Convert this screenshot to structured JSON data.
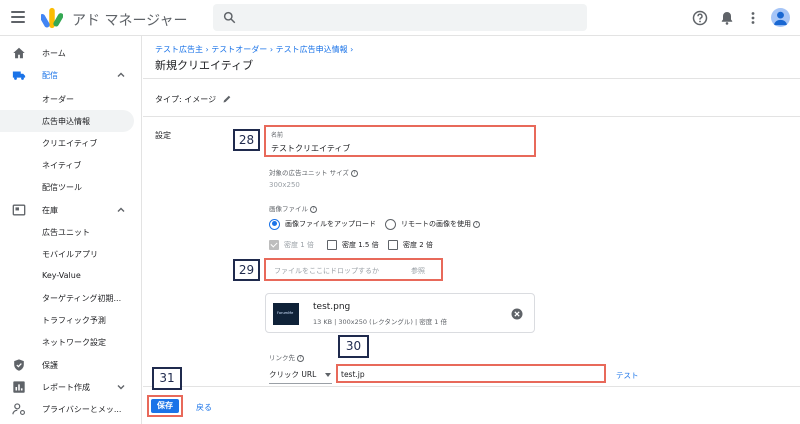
{
  "app": {
    "title": "アド マネージャー"
  },
  "sidebar": {
    "home": "ホーム",
    "delivery": "配信",
    "delivery_items": [
      "オーダー",
      "広告申込情報",
      "クリエイティブ",
      "ネイティブ",
      "配信ツール"
    ],
    "inventory": "在庫",
    "inventory_items": [
      "広告ユニット",
      "モバイルアプリ",
      "Key-Value",
      "ターゲティング初期...",
      "トラフィック予測",
      "ネットワーク設定"
    ],
    "protection": "保護",
    "reporting": "レポート作成",
    "privacy": "プライバシーとメッ..."
  },
  "breadcrumb": {
    "items": [
      "テスト広告主",
      "テストオーダー",
      "テスト広告申込情報"
    ],
    "separator": "›"
  },
  "page": {
    "title": "新規クリエイティブ",
    "type_label": "タイプ: イメージ"
  },
  "form": {
    "settings_label": "設定",
    "name_caption": "名前",
    "name_value": "テストクリエイティブ",
    "ad_unit_size_label": "対象の広告ユニット サイズ",
    "ad_unit_size_value": "300x250",
    "image_file_label": "画像ファイル",
    "radio_upload": "画像ファイルをアップロード",
    "radio_remote": "リモートの画像を使用",
    "density_1x": "密度 1 倍",
    "density_15x": "密度 1.5 倍",
    "density_2x": "密度 2 倍",
    "drop_text": "ファイルをここにドロップするか",
    "browse": "参照",
    "file_name": "test.png",
    "file_meta": "13 KB | 300x250 (レクタングル) | 密度 1 倍",
    "thumb_text": "ForumMe",
    "link_label": "リンク先",
    "link_type": "クリック URL",
    "link_value": "test.jp",
    "test_link": "テスト",
    "help_glyph": "?"
  },
  "footer": {
    "save": "保存",
    "back": "戻る"
  },
  "markers": [
    "28",
    "29",
    "30",
    "31"
  ],
  "colors": {
    "accent": "#1a73e8",
    "highlight": "#e8695a",
    "marker_border": "#1f2a4d"
  }
}
